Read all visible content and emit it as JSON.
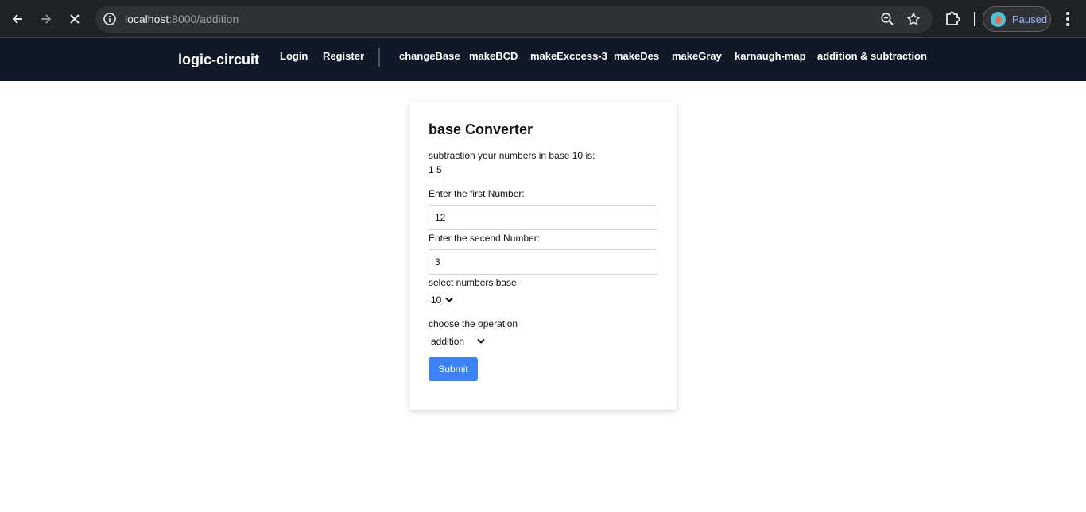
{
  "browser": {
    "url_host": "localhost",
    "url_path": ":8000/addition",
    "profile_label": "Paused"
  },
  "site_nav": {
    "brand": "logic-circuit",
    "links": [
      "Login",
      "Register",
      "changeBase",
      "makeBCD",
      "makeExccess-3",
      "makeDes",
      "makeGray",
      "karnaugh-map",
      "addition & subtraction"
    ]
  },
  "card": {
    "title": "base Converter",
    "result_label": "subtraction your numbers in base 10 is:",
    "result_value": "1 5",
    "first_label": "Enter the first Number:",
    "first_value": "12",
    "second_label": "Enter the secend Number:",
    "second_value": "3",
    "base_label": "select numbers base",
    "base_selected": "10",
    "operation_label": "choose the operation",
    "operation_selected": "addition",
    "submit_label": "Submit"
  },
  "icons": {
    "back": "arrow-left-icon",
    "forward": "arrow-right-icon",
    "stop": "close-icon",
    "site_info": "info-icon",
    "zoom": "zoom-out-icon",
    "bookmark": "star-icon",
    "extensions": "puzzle-icon",
    "menu": "kebab-menu-icon"
  },
  "colors": {
    "nav_bg": "#111827",
    "button_bg": "#3b82f6",
    "chrome_bg": "#202124"
  }
}
